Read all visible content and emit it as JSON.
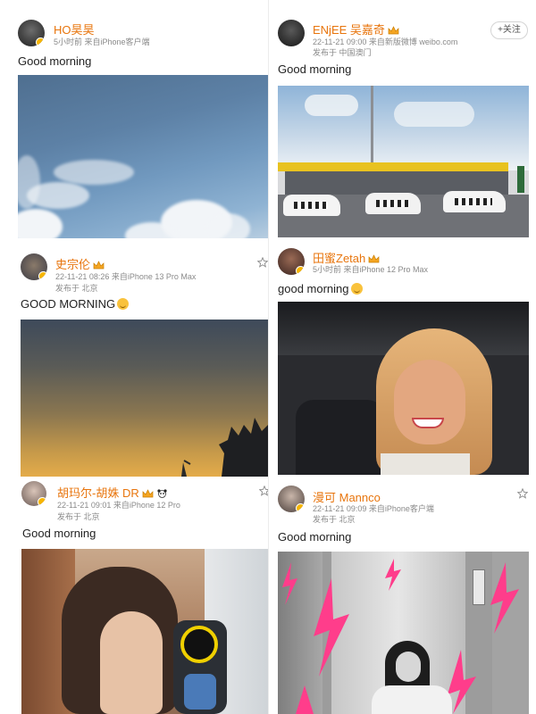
{
  "posts": {
    "p1": {
      "user": "HO昊昊",
      "meta1": "5小时前 来自iPhone客户端",
      "text": "Good morning",
      "avatar_icon": "avatar-ho"
    },
    "p2": {
      "user": "ENjEE 吴嘉奇",
      "meta1": "22-11-21 09:00  来自新版微博 weibo.com",
      "meta2": "发布于 中国澳门",
      "text": "Good morning",
      "follow_label": "+关注"
    },
    "p3": {
      "user": "史宗伦",
      "meta1": "22-11-21 08:26  来自iPhone 13 Pro Max",
      "meta2": "发布于 北京",
      "text": "GOOD MORNING"
    },
    "p4": {
      "user": "田蜜Zetah",
      "meta1": "5小时前 来自iPhone 12 Pro Max",
      "text": "good morning"
    },
    "p5": {
      "user": "胡玛尔-胡姝 DR",
      "meta1": "22-11-21 09:01  来自iPhone 12 Pro",
      "meta2": "发布于 北京",
      "text": "Good morning"
    },
    "p6": {
      "user": "漫可 Mannco",
      "meta1": "22-11-21 09:09  来自iPhone客户端",
      "meta2": "发布于 北京",
      "text": "Good morning"
    }
  },
  "colors": {
    "username": "#e8750d",
    "meta": "#8a8a8a",
    "verified_badge": "#f7b500"
  }
}
